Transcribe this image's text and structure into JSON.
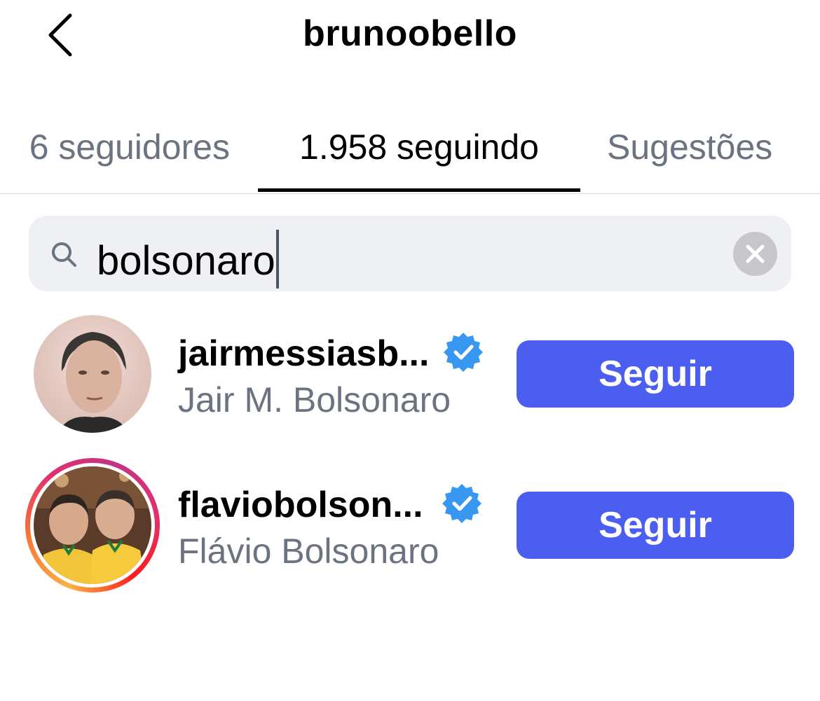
{
  "header": {
    "title": "brunoobello",
    "back_icon": "chevron-left-icon"
  },
  "tabs": [
    {
      "label": "6 seguidores",
      "active": false
    },
    {
      "label": "1.958 seguindo",
      "active": true
    },
    {
      "label": "Sugestões",
      "active": false
    }
  ],
  "search": {
    "value": "bolsonaro",
    "icon": "search-icon",
    "clear_icon": "clear-icon"
  },
  "results": [
    {
      "username": "jairmessiasb...",
      "full_name": "Jair M. Bolsonaro",
      "verified": true,
      "has_story_ring": false,
      "button_label": "Seguir"
    },
    {
      "username": "flaviobolson...",
      "full_name": "Flávio Bolsonaro",
      "verified": true,
      "has_story_ring": true,
      "button_label": "Seguir"
    }
  ],
  "colors": {
    "accent": "#4c5ef0",
    "verified": "#3897f0",
    "secondary_text": "#6b7280",
    "search_bg": "#eff0f3"
  }
}
